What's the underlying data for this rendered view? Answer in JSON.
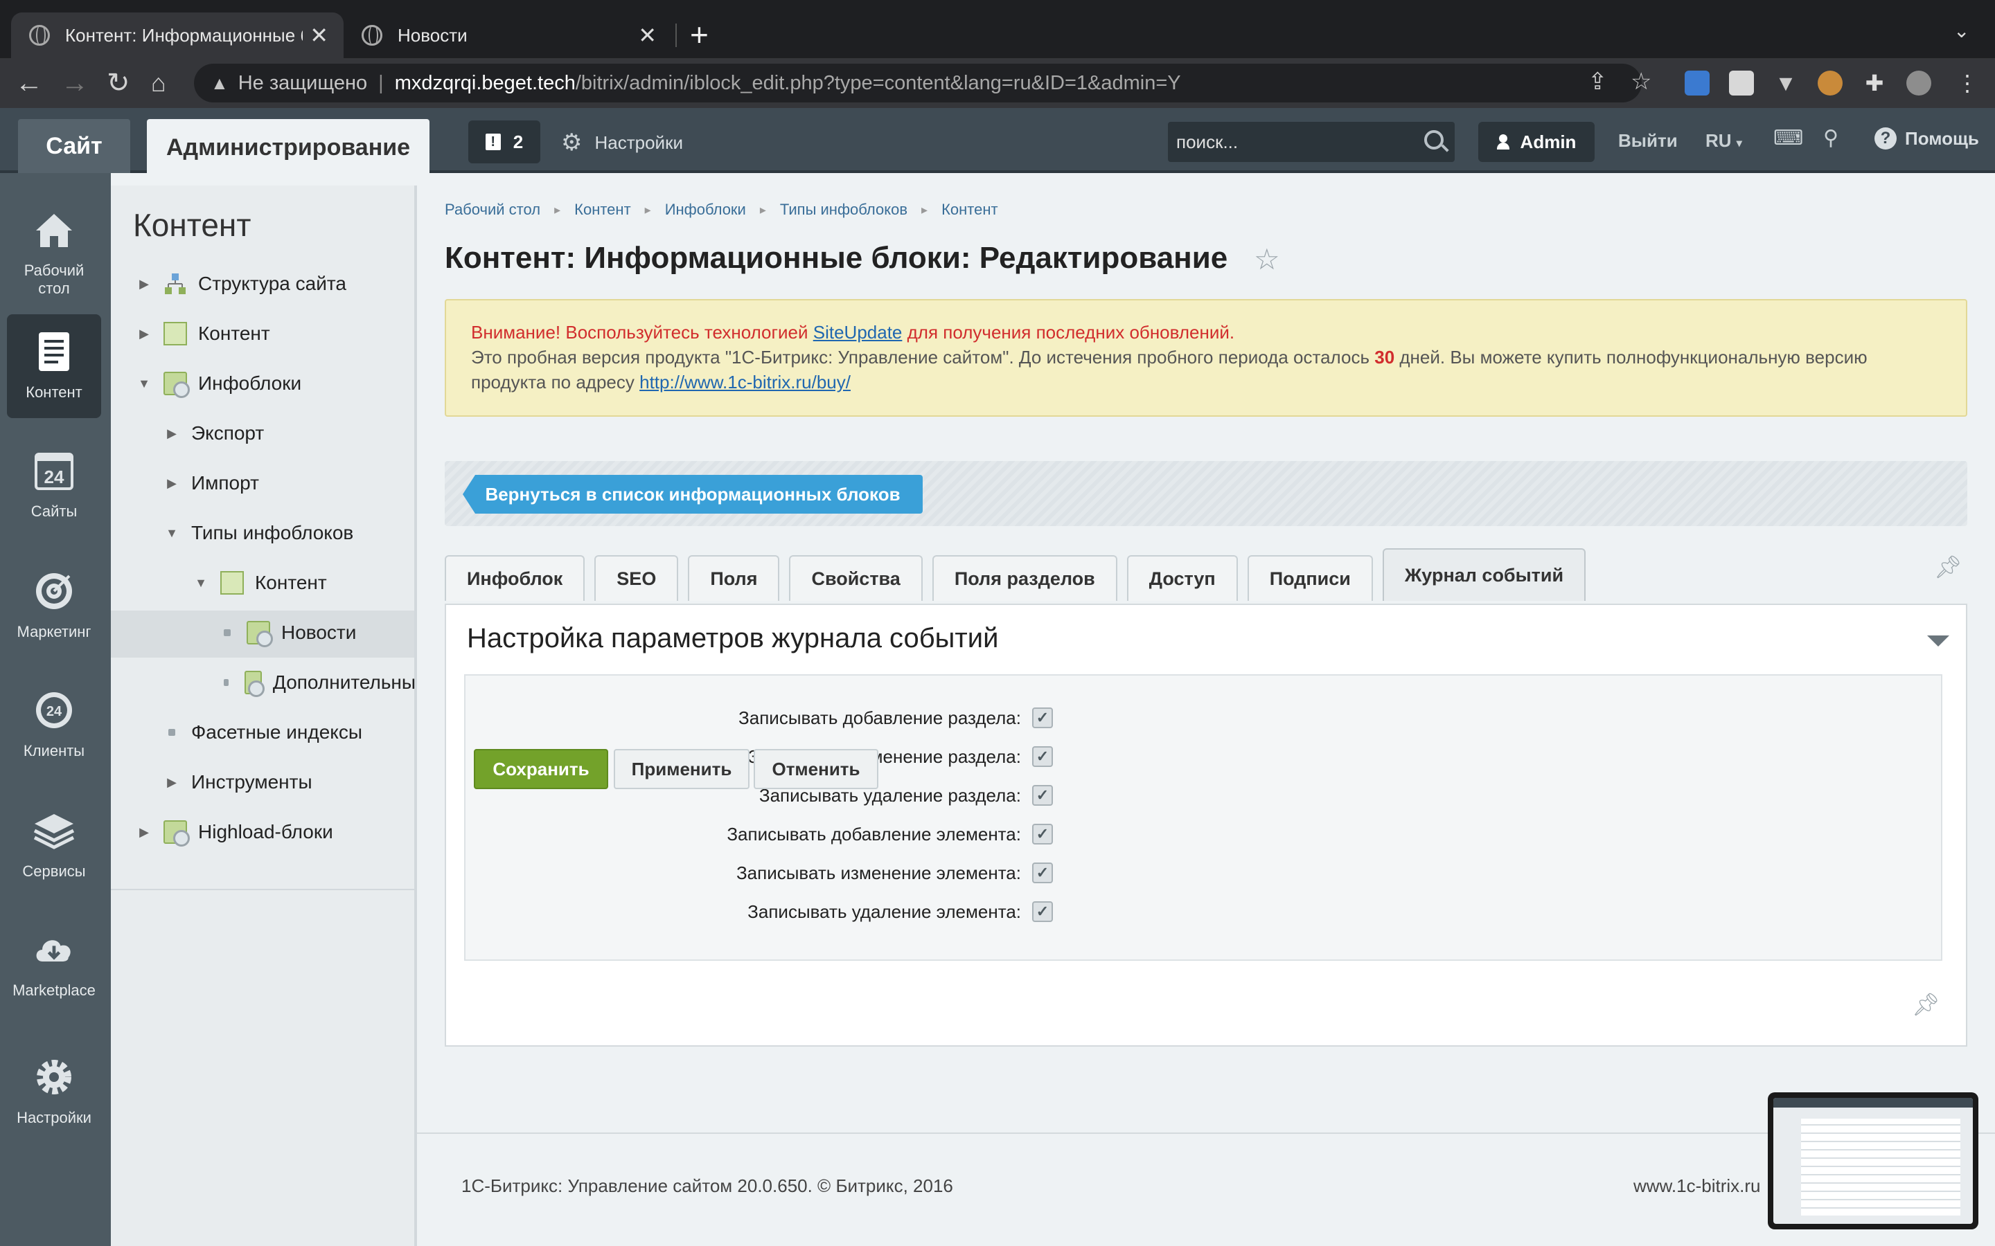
{
  "browser": {
    "tabs": [
      {
        "title": "Контент: Информационные б",
        "active": true
      },
      {
        "title": "Новости",
        "active": false
      }
    ],
    "new_tab": "+",
    "security_label": "Не защищено",
    "url_host": "mxdzqrqi.beget.tech",
    "url_path": "/bitrix/admin/iblock_edit.php?type=content&lang=ru&ID=1&admin=Y"
  },
  "topbar": {
    "site_label": "Сайт",
    "admin_label": "Администрирование",
    "notifications_count": "2",
    "settings_label": "Настройки",
    "search_placeholder": "поиск...",
    "user_label": "Admin",
    "logout_label": "Выйти",
    "lang_label": "RU",
    "help_label": "Помощь"
  },
  "icon_menu": [
    {
      "label": "Рабочий стол",
      "icon": "home-icon"
    },
    {
      "label": "Контент",
      "icon": "document-icon",
      "active": true
    },
    {
      "label": "Сайты",
      "icon": "calendar-24-icon"
    },
    {
      "label": "Маркетинг",
      "icon": "target-icon"
    },
    {
      "label": "Клиенты",
      "icon": "clients-24-icon"
    },
    {
      "label": "Сервисы",
      "icon": "layers-icon"
    },
    {
      "label": "Marketplace",
      "icon": "cloud-download-icon"
    },
    {
      "label": "Настройки",
      "icon": "gear-icon"
    }
  ],
  "tree": {
    "title": "Контент",
    "items": [
      {
        "label": "Структура сайта"
      },
      {
        "label": "Контент"
      },
      {
        "label": "Инфоблоки"
      },
      {
        "label": "Экспорт"
      },
      {
        "label": "Импорт"
      },
      {
        "label": "Типы инфоблоков"
      },
      {
        "label": "Контент"
      },
      {
        "label": "Новости"
      },
      {
        "label": "Дополнительны"
      },
      {
        "label": "Фасетные индексы"
      },
      {
        "label": "Инструменты"
      },
      {
        "label": "Highload-блоки"
      }
    ]
  },
  "breadcrumb": [
    "Рабочий стол",
    "Контент",
    "Инфоблоки",
    "Типы инфоблоков",
    "Контент"
  ],
  "page_title": "Контент: Информационные блоки: Редактирование",
  "alert": {
    "line1_prefix": "Внимание! Воспользуйтесь технологией ",
    "line1_link": "SiteUpdate",
    "line1_suffix": " для получения последних обновлений.",
    "line2_prefix": "Это пробная версия продукта \"1С-Битрикс: Управление сайтом\". До истечения пробного периода осталось ",
    "days": "30",
    "line2_suffix": " дней. Вы можете купить полнофункциональную версию",
    "line3_prefix": "продукта по адресу ",
    "line3_link": "http://www.1c-bitrix.ru/buy/"
  },
  "back_button": "Вернуться в список информационных блоков",
  "tabs": [
    "Инфоблок",
    "SEO",
    "Поля",
    "Свойства",
    "Поля разделов",
    "Доступ",
    "Подписи",
    "Журнал событий"
  ],
  "active_tab": "Журнал событий",
  "panel": {
    "heading": "Настройка параметров журнала событий",
    "fields": [
      {
        "label": "Записывать добавление раздела:",
        "checked": true
      },
      {
        "label": "Записывать изменение раздела:",
        "checked": true
      },
      {
        "label": "Записывать удаление раздела:",
        "checked": true
      },
      {
        "label": "Записывать добавление элемента:",
        "checked": true
      },
      {
        "label": "Записывать изменение элемента:",
        "checked": true
      },
      {
        "label": "Записывать удаление элемента:",
        "checked": true
      }
    ]
  },
  "buttons": {
    "save": "Сохранить",
    "apply": "Применить",
    "cancel": "Отменить"
  },
  "footer": {
    "left": "1С-Битрикс: Управление сайтом 20.0.650. © Битрикс, 2016",
    "right": "www.1c-bitrix.ru"
  },
  "colors": {
    "topbar": "#3f4b54",
    "save_green": "#73a22a",
    "back_blue": "#3aa0d8",
    "alert_bg": "#f5f0c4",
    "alert_red": "#d12d2d"
  }
}
